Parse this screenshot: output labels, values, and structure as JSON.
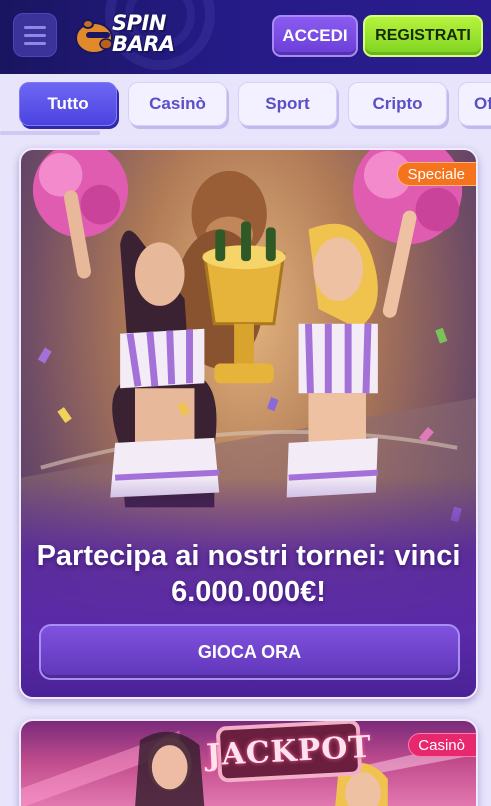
{
  "header": {
    "logo_line1": "SPIN",
    "logo_line2": "BARA",
    "login_label": "ACCEDI",
    "register_label": "REGISTRATI"
  },
  "tabs": [
    {
      "label": "Tutto",
      "active": true
    },
    {
      "label": "Casinò",
      "active": false
    },
    {
      "label": "Sport",
      "active": false
    },
    {
      "label": "Cripto",
      "active": false
    },
    {
      "label": "Of",
      "active": false
    }
  ],
  "promos": [
    {
      "badge": "Speciale",
      "title": "Partecipa ai nostri tornei: vinci 6.000.000€!",
      "cta": "GIOCA ORA"
    },
    {
      "badge": "Casinò",
      "image_text": "JACKPOT"
    }
  ],
  "colors": {
    "header_bg": "#251b86",
    "page_bg": "#e8e4fb",
    "login_btn": "#7a4de6",
    "register_btn": "#9be02e",
    "tab_active": "#5a52ea",
    "badge_special": "#f5731d",
    "badge_casino": "#e8286e"
  },
  "icons": [
    "menu-icon",
    "capybara-logo-icon"
  ]
}
